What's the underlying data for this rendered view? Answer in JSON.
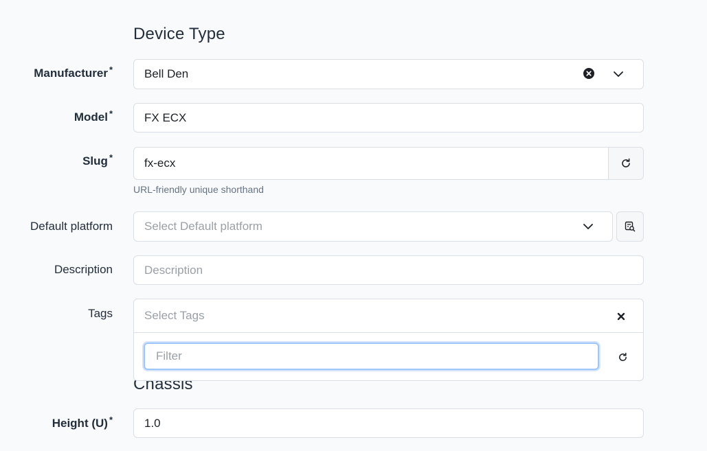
{
  "sections": {
    "device_type_title": "Device Type",
    "chassis_title": "Chassis"
  },
  "fields": {
    "manufacturer": {
      "label": "Manufacturer",
      "required_mark": "*",
      "value": "Bell Den"
    },
    "model": {
      "label": "Model",
      "required_mark": "*",
      "value": "FX ECX"
    },
    "slug": {
      "label": "Slug",
      "required_mark": "*",
      "value": "fx-ecx",
      "help": "URL-friendly unique shorthand"
    },
    "default_platform": {
      "label": "Default platform",
      "placeholder": "Select Default platform"
    },
    "description": {
      "label": "Description",
      "placeholder": "Description"
    },
    "tags": {
      "label": "Tags",
      "placeholder": "Select Tags",
      "filter_placeholder": "Filter"
    },
    "height": {
      "label": "Height (U)",
      "required_mark": "*",
      "value": "1.0"
    }
  },
  "icons": {
    "clear": "close-circle-icon",
    "dropdown": "chevron-down-icon",
    "regenerate": "refresh-icon",
    "platform_lookup": "search-list-icon",
    "tags_clear": "close-icon",
    "tags_refresh": "refresh-icon"
  }
}
